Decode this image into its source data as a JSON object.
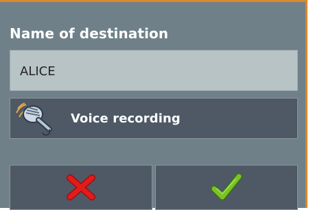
{
  "dialog": {
    "title": "Name of destination",
    "name_field": {
      "value": "ALICE"
    },
    "voice_button": {
      "label": "Voice recording",
      "icon": "microphone-icon"
    },
    "actions": {
      "cancel_icon": "cancel-x-icon",
      "confirm_icon": "confirm-check-icon"
    },
    "colors": {
      "background": "#6f8088",
      "button": "#4e5965",
      "field": "#b8c3c5",
      "frame": "#d98a2b",
      "cancel": "#e31b1b",
      "confirm": "#7bc225"
    }
  }
}
